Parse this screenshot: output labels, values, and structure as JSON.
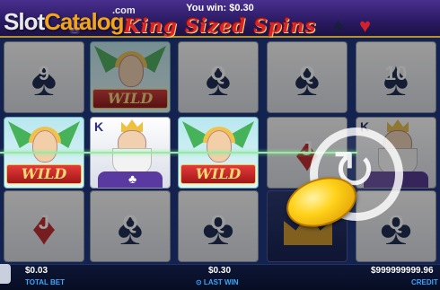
{
  "header": {
    "win_text": "You win: $0.30",
    "game_title": "King Sized Spins",
    "deco_icons": [
      "club-icon",
      "spade-icon",
      "heart-icon"
    ]
  },
  "watermark": {
    "slot": "Slot",
    "catalog": "Catalog",
    "com": ".com"
  },
  "reels": {
    "row1": [
      "9",
      "WILD",
      "Q",
      "Q",
      "10"
    ],
    "row2": [
      "WILD",
      "K",
      "WILD",
      "J",
      "K"
    ],
    "row3": [
      "J",
      "Q",
      "Q",
      "crown",
      "Q"
    ],
    "wild_label": "WILD",
    "king_letter": "K"
  },
  "spin_button": {
    "icon": "spin-arrow-icon",
    "coin_icon": "gold-coin-icon"
  },
  "bottom_bar": {
    "total_bet_value": "$0.03",
    "total_bet_label": "TOTAL BET",
    "last_win_value": "$0.30",
    "last_win_label": "⊙ LAST WIN",
    "credit_value": "$999999999.96",
    "credit_label": "CREDIT"
  },
  "colors": {
    "accent_blue": "#39a7ff",
    "title_red": "#d9252a",
    "gold": "#f6d670"
  }
}
